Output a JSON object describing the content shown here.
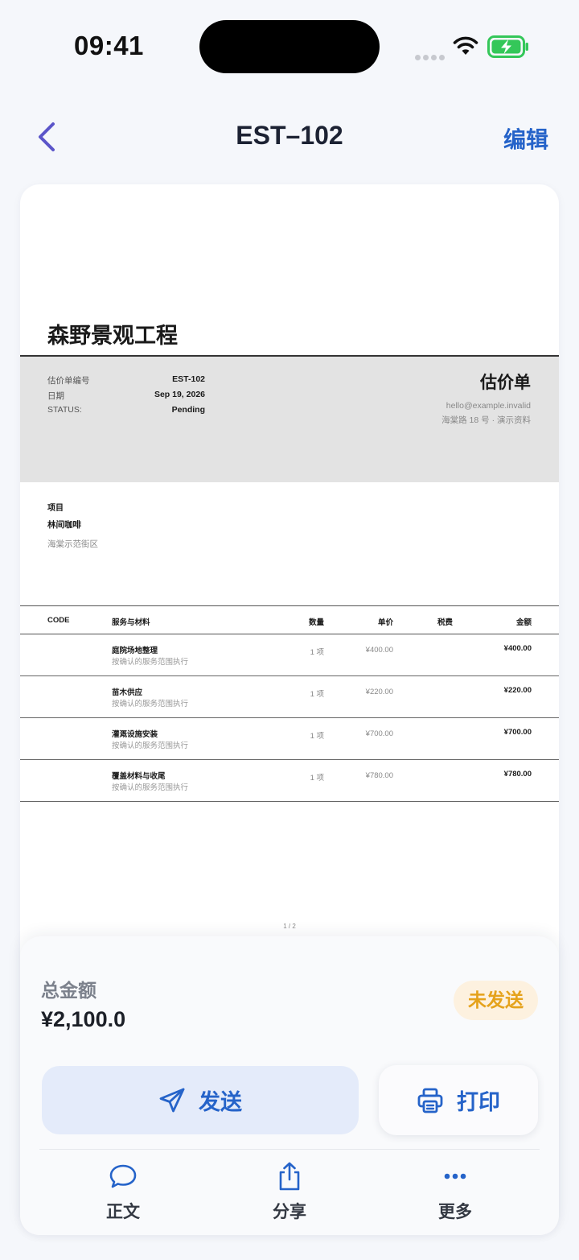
{
  "status_bar": {
    "time": "09:41"
  },
  "nav": {
    "title": "EST–102",
    "edit_label": "编辑"
  },
  "document": {
    "company_name": "森野景观工程",
    "meta": [
      {
        "label": "估价单编号",
        "value": "EST-102"
      },
      {
        "label": "日期",
        "value": "Sep 19, 2026"
      },
      {
        "label": "STATUS:",
        "value": "Pending"
      }
    ],
    "doc_type": "估价单",
    "contact_email": "hello@example.invalid",
    "contact_address": "海棠路 18 号 · 演示资料",
    "project_label": "项目",
    "project_name": "林间咖啡",
    "project_location": "海棠示范街区",
    "table": {
      "headers": {
        "code": "CODE",
        "desc": "服务与材料",
        "qty": "数量",
        "unit": "单价",
        "tax": "税费",
        "amount": "金额"
      },
      "rows": [
        {
          "name": "庭院场地整理",
          "note": "按确认的服务范围执行",
          "qty": "1 项",
          "unit": "¥400.00",
          "amount": "¥400.00"
        },
        {
          "name": "苗木供应",
          "note": "按确认的服务范围执行",
          "qty": "1 项",
          "unit": "¥220.00",
          "amount": "¥220.00"
        },
        {
          "name": "灌溉设施安装",
          "note": "按确认的服务范围执行",
          "qty": "1 项",
          "unit": "¥700.00",
          "amount": "¥700.00"
        },
        {
          "name": "覆盖材料与收尾",
          "note": "按确认的服务范围执行",
          "qty": "1 项",
          "unit": "¥780.00",
          "amount": "¥780.00"
        }
      ]
    },
    "page_indicator": "1 / 2"
  },
  "summary": {
    "total_label": "总金额",
    "total_value": "¥2,100.0",
    "status": "未发送",
    "send_label": "发送",
    "print_label": "打印"
  },
  "tabs": [
    {
      "label": "正文",
      "icon": "chat-bubble-icon"
    },
    {
      "label": "分享",
      "icon": "share-icon"
    },
    {
      "label": "更多",
      "icon": "more-icon"
    }
  ],
  "colors": {
    "accent": "#2563c9",
    "status_pending": "#e5a21b",
    "back_chevron": "#5b55c9",
    "battery": "#34c759"
  }
}
